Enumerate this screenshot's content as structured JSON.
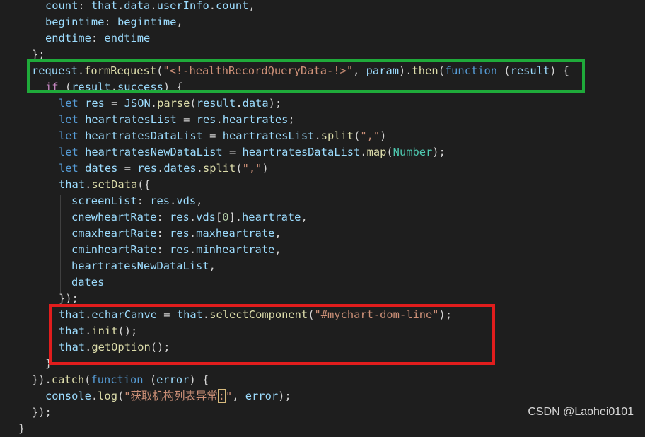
{
  "colors": {
    "background": "#1e1e1e",
    "green_box": "#1faa3a",
    "red_box": "#e11d1d"
  },
  "code": {
    "lines": [
      {
        "tokens": [
          {
            "t": "count",
            "c": "obj"
          },
          {
            "t": ": ",
            "c": "pl"
          },
          {
            "t": "that",
            "c": "obj"
          },
          {
            "t": ".",
            "c": "pl"
          },
          {
            "t": "data",
            "c": "obj"
          },
          {
            "t": ".",
            "c": "pl"
          },
          {
            "t": "userInfo",
            "c": "obj"
          },
          {
            "t": ".",
            "c": "pl"
          },
          {
            "t": "count",
            "c": "obj"
          },
          {
            "t": ",",
            "c": "pl"
          }
        ]
      },
      {
        "tokens": [
          {
            "t": "begintime",
            "c": "obj"
          },
          {
            "t": ": ",
            "c": "pl"
          },
          {
            "t": "begintime",
            "c": "obj"
          },
          {
            "t": ",",
            "c": "pl"
          }
        ]
      },
      {
        "tokens": [
          {
            "t": "endtime",
            "c": "obj"
          },
          {
            "t": ": ",
            "c": "pl"
          },
          {
            "t": "endtime",
            "c": "obj"
          }
        ]
      },
      {
        "tokens": [
          {
            "t": "};",
            "c": "pl"
          }
        ]
      },
      {
        "tokens": [
          {
            "t": "request",
            "c": "obj"
          },
          {
            "t": ".",
            "c": "pl"
          },
          {
            "t": "formRequest",
            "c": "fn"
          },
          {
            "t": "(",
            "c": "pl"
          },
          {
            "t": "\"<!-healthRecordQueryData-!>\"",
            "c": "str"
          },
          {
            "t": ", ",
            "c": "pl"
          },
          {
            "t": "param",
            "c": "obj"
          },
          {
            "t": ").",
            "c": "pl"
          },
          {
            "t": "then",
            "c": "fn"
          },
          {
            "t": "(",
            "c": "pl"
          },
          {
            "t": "function",
            "c": "kw"
          },
          {
            "t": " (",
            "c": "pl"
          },
          {
            "t": "result",
            "c": "obj"
          },
          {
            "t": ") {",
            "c": "pl"
          }
        ]
      },
      {
        "tokens": [
          {
            "t": "if",
            "c": "ctl"
          },
          {
            "t": " (",
            "c": "pl"
          },
          {
            "t": "result",
            "c": "obj"
          },
          {
            "t": ".",
            "c": "pl"
          },
          {
            "t": "success",
            "c": "obj"
          },
          {
            "t": ") {",
            "c": "pl"
          }
        ]
      },
      {
        "tokens": [
          {
            "t": "let",
            "c": "kw"
          },
          {
            "t": " ",
            "c": "pl"
          },
          {
            "t": "res",
            "c": "obj"
          },
          {
            "t": " = ",
            "c": "pl"
          },
          {
            "t": "JSON",
            "c": "obj"
          },
          {
            "t": ".",
            "c": "pl"
          },
          {
            "t": "parse",
            "c": "fn"
          },
          {
            "t": "(",
            "c": "pl"
          },
          {
            "t": "result",
            "c": "obj"
          },
          {
            "t": ".",
            "c": "pl"
          },
          {
            "t": "data",
            "c": "obj"
          },
          {
            "t": ");",
            "c": "pl"
          }
        ]
      },
      {
        "tokens": [
          {
            "t": "let",
            "c": "kw"
          },
          {
            "t": " ",
            "c": "pl"
          },
          {
            "t": "heartratesList",
            "c": "obj"
          },
          {
            "t": " = ",
            "c": "pl"
          },
          {
            "t": "res",
            "c": "obj"
          },
          {
            "t": ".",
            "c": "pl"
          },
          {
            "t": "heartrates",
            "c": "obj"
          },
          {
            "t": ";",
            "c": "pl"
          }
        ]
      },
      {
        "tokens": [
          {
            "t": "let",
            "c": "kw"
          },
          {
            "t": " ",
            "c": "pl"
          },
          {
            "t": "heartratesDataList",
            "c": "obj"
          },
          {
            "t": " = ",
            "c": "pl"
          },
          {
            "t": "heartratesList",
            "c": "obj"
          },
          {
            "t": ".",
            "c": "pl"
          },
          {
            "t": "split",
            "c": "fn"
          },
          {
            "t": "(",
            "c": "pl"
          },
          {
            "t": "\",\"",
            "c": "str"
          },
          {
            "t": ")",
            "c": "pl"
          }
        ]
      },
      {
        "tokens": [
          {
            "t": "let",
            "c": "kw"
          },
          {
            "t": " ",
            "c": "pl"
          },
          {
            "t": "heartratesNewDataList",
            "c": "obj"
          },
          {
            "t": " = ",
            "c": "pl"
          },
          {
            "t": "heartratesDataList",
            "c": "obj"
          },
          {
            "t": ".",
            "c": "pl"
          },
          {
            "t": "map",
            "c": "fn"
          },
          {
            "t": "(",
            "c": "pl"
          },
          {
            "t": "Number",
            "c": "cls"
          },
          {
            "t": ");",
            "c": "pl"
          }
        ]
      },
      {
        "tokens": [
          {
            "t": "let",
            "c": "kw"
          },
          {
            "t": " ",
            "c": "pl"
          },
          {
            "t": "dates",
            "c": "obj"
          },
          {
            "t": " = ",
            "c": "pl"
          },
          {
            "t": "res",
            "c": "obj"
          },
          {
            "t": ".",
            "c": "pl"
          },
          {
            "t": "dates",
            "c": "obj"
          },
          {
            "t": ".",
            "c": "pl"
          },
          {
            "t": "split",
            "c": "fn"
          },
          {
            "t": "(",
            "c": "pl"
          },
          {
            "t": "\",\"",
            "c": "str"
          },
          {
            "t": ")",
            "c": "pl"
          }
        ]
      },
      {
        "tokens": [
          {
            "t": "that",
            "c": "obj"
          },
          {
            "t": ".",
            "c": "pl"
          },
          {
            "t": "setData",
            "c": "fn"
          },
          {
            "t": "({",
            "c": "pl"
          }
        ]
      },
      {
        "tokens": [
          {
            "t": "screenList",
            "c": "obj"
          },
          {
            "t": ": ",
            "c": "pl"
          },
          {
            "t": "res",
            "c": "obj"
          },
          {
            "t": ".",
            "c": "pl"
          },
          {
            "t": "vds",
            "c": "obj"
          },
          {
            "t": ",",
            "c": "pl"
          }
        ]
      },
      {
        "tokens": [
          {
            "t": "cnewheartRate",
            "c": "obj"
          },
          {
            "t": ": ",
            "c": "pl"
          },
          {
            "t": "res",
            "c": "obj"
          },
          {
            "t": ".",
            "c": "pl"
          },
          {
            "t": "vds",
            "c": "obj"
          },
          {
            "t": "[",
            "c": "pl"
          },
          {
            "t": "0",
            "c": "num"
          },
          {
            "t": "].",
            "c": "pl"
          },
          {
            "t": "heartrate",
            "c": "obj"
          },
          {
            "t": ",",
            "c": "pl"
          }
        ]
      },
      {
        "tokens": [
          {
            "t": "cmaxheartRate",
            "c": "obj"
          },
          {
            "t": ": ",
            "c": "pl"
          },
          {
            "t": "res",
            "c": "obj"
          },
          {
            "t": ".",
            "c": "pl"
          },
          {
            "t": "maxheartrate",
            "c": "obj"
          },
          {
            "t": ",",
            "c": "pl"
          }
        ]
      },
      {
        "tokens": [
          {
            "t": "cminheartRate",
            "c": "obj"
          },
          {
            "t": ": ",
            "c": "pl"
          },
          {
            "t": "res",
            "c": "obj"
          },
          {
            "t": ".",
            "c": "pl"
          },
          {
            "t": "minheartrate",
            "c": "obj"
          },
          {
            "t": ",",
            "c": "pl"
          }
        ]
      },
      {
        "tokens": [
          {
            "t": "heartratesNewDataList",
            "c": "obj"
          },
          {
            "t": ",",
            "c": "pl"
          }
        ]
      },
      {
        "tokens": [
          {
            "t": "dates",
            "c": "obj"
          }
        ]
      },
      {
        "tokens": [
          {
            "t": "});",
            "c": "pl"
          }
        ]
      },
      {
        "tokens": [
          {
            "t": "that",
            "c": "obj"
          },
          {
            "t": ".",
            "c": "pl"
          },
          {
            "t": "echarCanve",
            "c": "obj"
          },
          {
            "t": " = ",
            "c": "pl"
          },
          {
            "t": "that",
            "c": "obj"
          },
          {
            "t": ".",
            "c": "pl"
          },
          {
            "t": "selectComponent",
            "c": "fn"
          },
          {
            "t": "(",
            "c": "pl"
          },
          {
            "t": "\"#mychart-dom-line\"",
            "c": "str"
          },
          {
            "t": ");",
            "c": "pl"
          }
        ]
      },
      {
        "tokens": [
          {
            "t": "that",
            "c": "obj"
          },
          {
            "t": ".",
            "c": "pl"
          },
          {
            "t": "init",
            "c": "fn"
          },
          {
            "t": "();",
            "c": "pl"
          }
        ]
      },
      {
        "tokens": [
          {
            "t": "that",
            "c": "obj"
          },
          {
            "t": ".",
            "c": "pl"
          },
          {
            "t": "getOption",
            "c": "fn"
          },
          {
            "t": "();",
            "c": "pl"
          }
        ]
      },
      {
        "tokens": [
          {
            "t": "}",
            "c": "pl"
          }
        ]
      },
      {
        "tokens": [
          {
            "t": "}).",
            "c": "pl"
          },
          {
            "t": "catch",
            "c": "fn"
          },
          {
            "t": "(",
            "c": "pl"
          },
          {
            "t": "function",
            "c": "kw"
          },
          {
            "t": " (",
            "c": "pl"
          },
          {
            "t": "error",
            "c": "obj"
          },
          {
            "t": ") {",
            "c": "pl"
          }
        ]
      },
      {
        "tokens": [
          {
            "t": "console",
            "c": "obj"
          },
          {
            "t": ".",
            "c": "pl"
          },
          {
            "t": "log",
            "c": "fn"
          },
          {
            "t": "(",
            "c": "pl"
          },
          {
            "t": "\"获取机构列表异常",
            "c": "str"
          },
          {
            "t": ":",
            "c": "str",
            "box": true
          },
          {
            "t": "\"",
            "c": "str"
          },
          {
            "t": ", ",
            "c": "pl"
          },
          {
            "t": "error",
            "c": "obj"
          },
          {
            "t": ");",
            "c": "pl"
          }
        ]
      },
      {
        "tokens": [
          {
            "t": "});",
            "c": "pl"
          }
        ]
      },
      {
        "tokens": [
          {
            "t": "}",
            "c": "pl"
          }
        ]
      }
    ]
  },
  "watermark": "CSDN @Laohei0101"
}
